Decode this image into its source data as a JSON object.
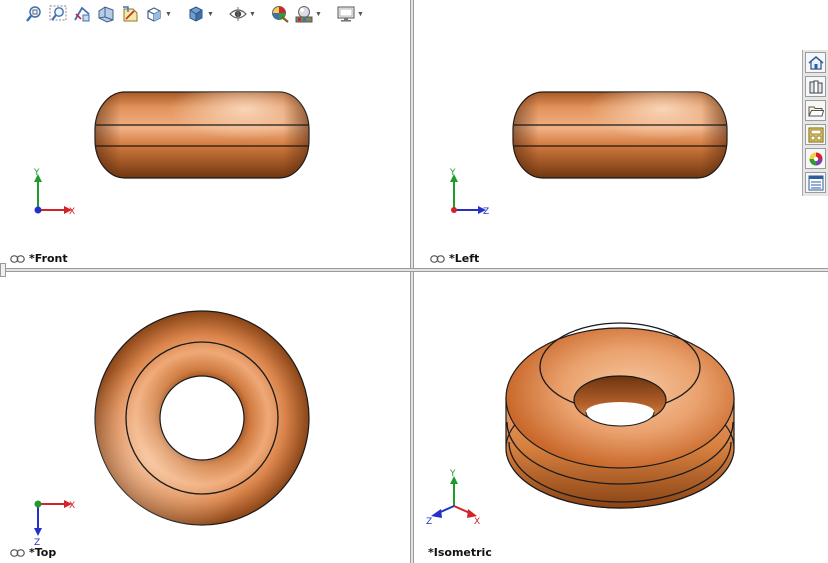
{
  "toolbar": {
    "items": [
      {
        "icon": "zoom-to-fit-icon"
      },
      {
        "icon": "zoom-to-area-icon"
      },
      {
        "icon": "previous-view-icon"
      },
      {
        "icon": "section-view-icon"
      },
      {
        "icon": "dynamic-annotation-views-icon"
      },
      {
        "icon": "view-orientation-icon"
      },
      {
        "icon": "display-style-icon"
      },
      {
        "icon": "hide-show-items-icon"
      },
      {
        "icon": "edit-appearance-icon"
      },
      {
        "icon": "apply-scene-icon"
      },
      {
        "icon": "view-settings-icon"
      }
    ]
  },
  "viewports": {
    "front": {
      "label": "*Front",
      "axis_a": "Y",
      "axis_b": "X"
    },
    "left": {
      "label": "*Left",
      "axis_a": "Y",
      "axis_b": "Z"
    },
    "top": {
      "label": "*Top",
      "axis_a": "X",
      "axis_b": "Z"
    },
    "isometric": {
      "label": "*Isometric",
      "axis_y": "Y",
      "axis_x": "X",
      "axis_z": "Z"
    }
  },
  "task_pane": {
    "items": [
      {
        "icon": "home-icon"
      },
      {
        "icon": "design-library-icon"
      },
      {
        "icon": "file-explorer-icon"
      },
      {
        "icon": "view-palette-icon"
      },
      {
        "icon": "appearances-scenes-icon"
      },
      {
        "icon": "custom-properties-icon"
      }
    ]
  },
  "colors": {
    "model_orange": "#d9834a",
    "model_highlight": "#f6c9a2",
    "model_shadow": "#7e3f16",
    "edge": "#1a1a1a",
    "axis_y": "#1f9a2b",
    "axis_x": "#d2232a",
    "axis_z": "#2430c8"
  }
}
